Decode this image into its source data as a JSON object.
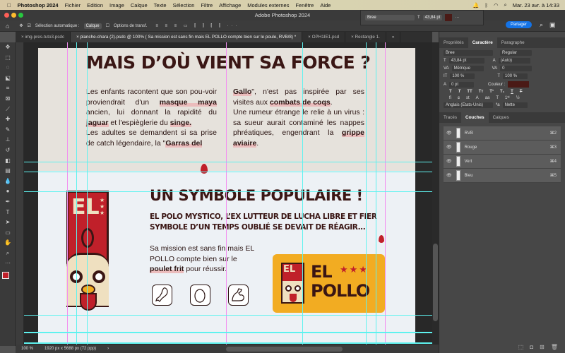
{
  "menubar": {
    "app": "Photoshop 2024",
    "items": [
      "Fichier",
      "Edition",
      "Image",
      "Calque",
      "Texte",
      "Sélection",
      "Filtre",
      "Affichage",
      "Modules externes",
      "Fenêtre",
      "Aide"
    ],
    "datetime": "Mar. 23 avr. à 14:33"
  },
  "titlebar": {
    "title": "Adobe Photoshop 2024"
  },
  "floatbar": {
    "font": "Bree",
    "size": "43,84 pt",
    "color": "#4a1a16"
  },
  "options": {
    "auto_select_label": "Sélection automatique :",
    "auto_select_value": "Calque",
    "transform_label": "Options de transf.",
    "share": "Partager"
  },
  "tabs": [
    {
      "label": "img-pres-tuto3.psdc",
      "active": false
    },
    {
      "label": "planche-chara (2).psdc @ 100% ( Sa mission est sans fin mais EL POLLO compte bien sur le poule, RVB/8) *",
      "active": true
    },
    {
      "label": "OPH1IE1.psd",
      "active": false
    },
    {
      "label": "Rectangle 1.",
      "active": false
    }
  ],
  "doc": {
    "title1": "MAIS D’OÙ VIENT SA FORCE ?",
    "col1": [
      "Les enfants racontent que son pou-voir proviendrait d'un ",
      "masque maya",
      " ancien, lui donnant la rapidité du ",
      "jaguar",
      " et l'espièglerie du ",
      "singe.",
      "Les adultes se demandent si sa prise de catch légendaire, la \"",
      "Garras del"
    ],
    "col2": [
      "Gallo",
      "\", n'est pas inspirée par ses visites aux ",
      "combats de coqs",
      ".",
      "Une rumeur étrange le relie à un virus : sa sueur aurait contaminé les nappes phréatiques, engendrant la ",
      "grippe aviaire",
      "."
    ],
    "title2": "UN SYMBOLE POPULAIRE !",
    "subtitle": "EL POLO MYSTICO, L’EX LUTTEUR DE LUCHA LIBRE ET FIER SYMBOLE D’UN TEMPS OUBLIÉ SE DEVAIT DE RÉAGIR...",
    "mission": [
      "Sa mission est sans fin mais EL POLLO compte bien sur le ",
      "poulet frit",
      " pour réussir."
    ],
    "logo_text": "EL POLLO",
    "badge_el": "EL",
    "accent": "#c0202a",
    "orange": "#f2ac22",
    "dark": "#3a1614"
  },
  "status": {
    "zoom": "100 %",
    "dims": "1920 px x 5688 px (72 ppp)"
  },
  "panel": {
    "tabs": [
      "Propriétés",
      "Caractère",
      "Paragraphe"
    ],
    "font": "Bree",
    "style": "Regular",
    "size": "43,84 pt",
    "leading": "(Auto)",
    "kerning": "Métrique",
    "tracking": "0",
    "vscale": "100 %",
    "hscale": "100 %",
    "baseline": "0 pt",
    "color_label": "Couleur :",
    "color": "#4a1a16",
    "language": "Anglais (Etats-Unis)",
    "aa": "Nette",
    "tabs2": [
      "Tracés",
      "Couches",
      "Calques"
    ],
    "channels": [
      {
        "name": "RVB",
        "key": "⌘2"
      },
      {
        "name": "Rouge",
        "key": "⌘3"
      },
      {
        "name": "Vert",
        "key": "⌘4"
      },
      {
        "name": "Bleu",
        "key": "⌘5"
      }
    ]
  }
}
